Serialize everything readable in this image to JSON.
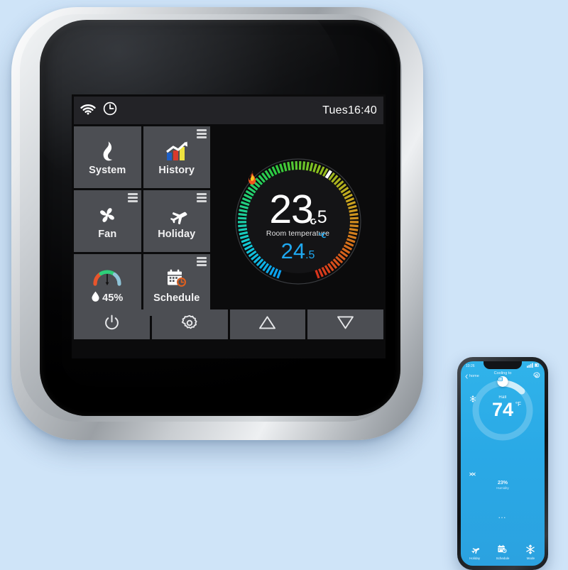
{
  "background_color": "#cfe4f8",
  "thermostat": {
    "device_name": "smart-wifi-thermostat",
    "bezel_color": "#c3c7cb",
    "screen_bg": "#0b0b0c",
    "statusbar": {
      "icons": [
        "wifi-icon",
        "clock-icon"
      ],
      "time": "Tues16:40"
    },
    "tiles": [
      {
        "key": "system",
        "label": "System",
        "icon": "flame-icon",
        "menu": false
      },
      {
        "key": "history",
        "label": "History",
        "icon": "bar-chart-icon",
        "menu": true
      },
      {
        "key": "fan",
        "label": "Fan",
        "icon": "fan-icon",
        "menu": true
      },
      {
        "key": "holiday",
        "label": "Holiday",
        "icon": "airplane-icon",
        "menu": true
      },
      {
        "key": "humidity",
        "label": "45%",
        "icon": "humidity-gauge-icon",
        "menu": false
      },
      {
        "key": "schedule",
        "label": "Schedule",
        "icon": "calendar-clock-icon",
        "menu": true
      }
    ],
    "dial": {
      "mode_icon": "flame-icon",
      "room_temp_int": "23",
      "room_temp_dec": ".5",
      "room_unit": "℃",
      "room_label": "Room temperature",
      "set_temp_int": "24",
      "set_temp_dec": ".5",
      "set_unit": "℃",
      "set_color": "#1fa8f0",
      "marker_color": "#ffffff",
      "gradient_stops": [
        "#0a9ef0",
        "#13c9d6",
        "#22d07a",
        "#2ecc3f",
        "#8fbe1e",
        "#c9a520",
        "#d5701c",
        "#d8341c"
      ]
    },
    "buttons": [
      {
        "key": "power",
        "icon": "power-icon"
      },
      {
        "key": "settings",
        "icon": "gear-icon"
      },
      {
        "key": "up",
        "icon": "triangle-up-icon"
      },
      {
        "key": "down",
        "icon": "triangle-down-icon"
      }
    ]
  },
  "phone": {
    "app_bg": "#2ba9e6",
    "status": {
      "carrier": "10:26",
      "right": "signal-wifi-battery"
    },
    "back_label": "home",
    "settings_icon": "gear-icon",
    "title": "Cooling to",
    "room": "Hall",
    "temp": "74",
    "unit": "°F",
    "mode_icon": "snowflake-icon",
    "humidity_value": "23%",
    "humidity_label": "Humidity",
    "dots": "•••",
    "tabs": [
      {
        "key": "holiday",
        "label": "Holiday",
        "icon": "airplane-icon"
      },
      {
        "key": "schedule",
        "label": "Schedule",
        "icon": "calendar-clock-icon"
      },
      {
        "key": "mode",
        "label": "Mode",
        "icon": "snowflake-icon"
      }
    ]
  }
}
